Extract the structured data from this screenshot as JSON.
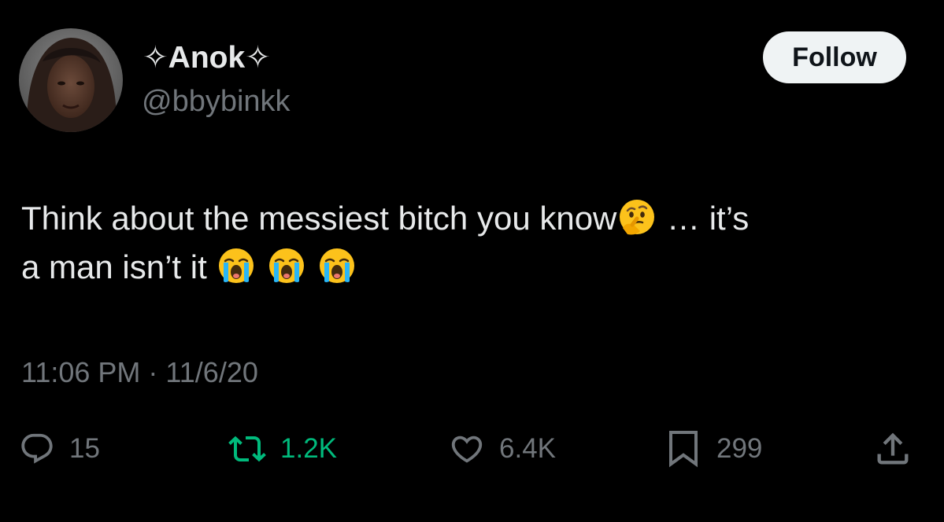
{
  "user": {
    "display_name": "✧Anok✧",
    "handle": "@bbybinkk"
  },
  "follow_button": {
    "label": "Follow"
  },
  "tweet": {
    "line1_text": "Think about the messiest bitch you know",
    "line1_emoji": "thinking-face",
    "line1_tail": " … it’s",
    "line2_text": "a man isn’t it ",
    "line2_emojis": [
      "loudly-crying-face",
      "loudly-crying-face",
      "loudly-crying-face"
    ]
  },
  "meta": {
    "time": "11:06 PM",
    "separator": " · ",
    "date": "11/6/20"
  },
  "actions": {
    "reply": {
      "icon": "reply-icon",
      "count": "15"
    },
    "retweet": {
      "icon": "retweet-icon",
      "count": "1.2K",
      "color": "#00ba7c"
    },
    "like": {
      "icon": "heart-icon",
      "count": "6.4K"
    },
    "bookmark": {
      "icon": "bookmark-icon",
      "count": "299"
    },
    "share": {
      "icon": "share-icon"
    }
  },
  "colors": {
    "background": "#000000",
    "primary_text": "#e7e9ea",
    "secondary_text": "#71767b",
    "follow_bg": "#eff3f4",
    "retweet_active": "#00ba7c"
  }
}
